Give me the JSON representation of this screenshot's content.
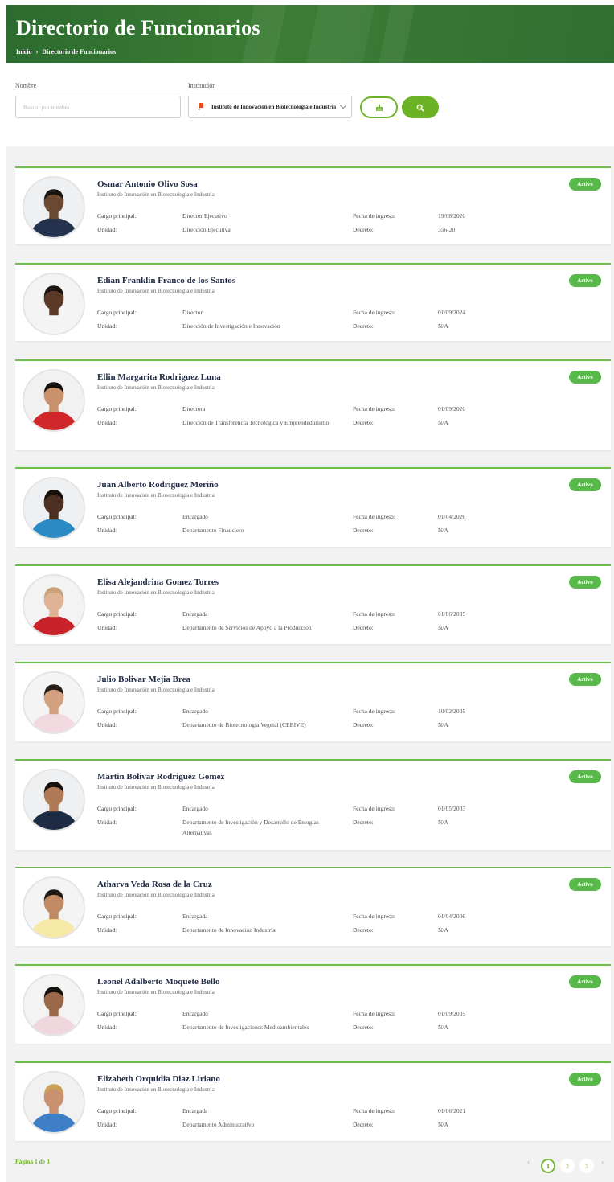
{
  "header": {
    "title": "Directorio de Funcionarios",
    "breadcrumb": [
      "Inicio",
      "›",
      "Directorio de Funcionarios"
    ]
  },
  "filters": {
    "name_label": "Nombre",
    "name_placeholder": "Buscar por nombre",
    "institution_label": "Institución",
    "institution_value": "Instituto de Innovación en Biotecnología e Industria",
    "clear_icon": "broom-icon",
    "search_icon": "search-icon"
  },
  "labels": {
    "cargo": "Cargo principal:",
    "unidad": "Unidad:",
    "fecha": "Fecha de ingreso:",
    "decreto": "Decreto:"
  },
  "officials": [
    {
      "name": "Osmar Antonio Olivo Sosa",
      "institution": "Instituto de Innovación en Biotecnología e Industria",
      "cargo": "Director Ejecutivo",
      "unidad": "Dirección Ejecutiva",
      "fecha": "19/08/2020",
      "decreto": "356-20",
      "status": "Activo"
    },
    {
      "name": "Edian Franklin Franco de los Santos",
      "institution": "Instituto de Innovación en Biotecnología e Industria",
      "cargo": "Director",
      "unidad": "Dirección de Investigación e Innovación",
      "fecha": "01/09/2024",
      "decreto": "N/A",
      "status": "Activo"
    },
    {
      "name": "Ellin Margarita Rodriguez Luna",
      "institution": "Instituto de Innovación en Biotecnología e Industria",
      "cargo": "Directora",
      "unidad": "Dirección de Transferencia Tecnológica y Emprendedurismo",
      "fecha": "01/09/2020",
      "decreto": "N/A",
      "status": "Activo"
    },
    {
      "name": "Juan Alberto Rodriguez Meriño",
      "institution": "Instituto de Innovación en Biotecnología e Industria",
      "cargo": "Encargado",
      "unidad": "Departamento Financiero",
      "fecha": "01/04/2026",
      "decreto": "N/A",
      "status": "Activo"
    },
    {
      "name": "Elisa Alejandrina Gomez Torres",
      "institution": "Instituto de Innovación en Biotecnología e Industria",
      "cargo": "Encargada",
      "unidad": "Departamento de Servicios de Apoyo a la Producción",
      "fecha": "01/06/2005",
      "decreto": "N/A",
      "status": "Activo"
    },
    {
      "name": "Julio Bolivar Mejia Brea",
      "institution": "Instituto de Innovación en Biotecnología e Industria",
      "cargo": "Encargado",
      "unidad": "Departamento de Biotecnología Vegetal (CEBIVE)",
      "fecha": "10/02/2005",
      "decreto": "N/A",
      "status": "Activo"
    },
    {
      "name": "Martin Bolivar Rodriguez Gomez",
      "institution": "Instituto de Innovación en Biotecnología e Industria",
      "cargo": "Encargado",
      "unidad": "Departamento de Investigación y Desarrollo de Energías Alternativas",
      "fecha": "01/05/2003",
      "decreto": "N/A",
      "status": "Activo"
    },
    {
      "name": "Atharva Veda Rosa de la Cruz",
      "institution": "Instituto de Innovación en Biotecnología e Industria",
      "cargo": "Encargada",
      "unidad": "Departamento de Innovación Industrial",
      "fecha": "01/04/2006",
      "decreto": "N/A",
      "status": "Activo"
    },
    {
      "name": "Leonel Adalberto Moquete Bello",
      "institution": "Instituto de Innovación en Biotecnología e Industria",
      "cargo": "Encargado",
      "unidad": "Departamento de Investigaciones Medioambientales",
      "fecha": "01/09/2005",
      "decreto": "N/A",
      "status": "Activo"
    },
    {
      "name": "Elizabeth Orquidia Diaz Liriano",
      "institution": "Instituto de Innovación en Biotecnología e Industria",
      "cargo": "Encargada",
      "unidad": "Departamento Administrativo",
      "fecha": "01/06/2021",
      "decreto": "N/A",
      "status": "Activo"
    }
  ],
  "avatars": [
    {
      "skin": "#6b4a33",
      "hair": "#1a1410",
      "shirt": "#24324e",
      "bg": "#eef0f2"
    },
    {
      "skin": "#5a3a26",
      "hair": "#1c140e",
      "shirt": "#f4f4f4",
      "bg": "#f3f3f3"
    },
    {
      "skin": "#c9906c",
      "hair": "#140f0c",
      "shirt": "#d1262a",
      "bg": "#f1f1f1"
    },
    {
      "skin": "#4b3021",
      "hair": "#15100c",
      "shirt": "#2a8ac4",
      "bg": "#eef0f2"
    },
    {
      "skin": "#e0b394",
      "hair": "#caa27a",
      "shirt": "#c8232a",
      "bg": "#f3f3f3"
    },
    {
      "skin": "#d3a17f",
      "hair": "#2a1f18",
      "shirt": "#f1d9df",
      "bg": "#f4f4f4"
    },
    {
      "skin": "#b07a56",
      "hair": "#17120e",
      "shirt": "#1d2b44",
      "bg": "#eef0f2"
    },
    {
      "skin": "#c18a64",
      "hair": "#1f1813",
      "shirt": "#f6e9a8",
      "bg": "#f4f4f4"
    },
    {
      "skin": "#9a6748",
      "hair": "#15110d",
      "shirt": "#f0d7dd",
      "bg": "#f3f3f3"
    },
    {
      "skin": "#c99170",
      "hair": "#caa056",
      "shirt": "#3f7fc6",
      "bg": "#f1f1f1"
    }
  ],
  "pagination": {
    "text_prefix": "Página",
    "current": "1",
    "text_mid": "de",
    "total": "3",
    "prev": "‹",
    "next": "›",
    "pages": [
      "1",
      "2",
      "3"
    ]
  },
  "colors": {
    "brand_green": "#2f6f31",
    "accent_green": "#6bb324",
    "status_green": "#58b94a"
  }
}
